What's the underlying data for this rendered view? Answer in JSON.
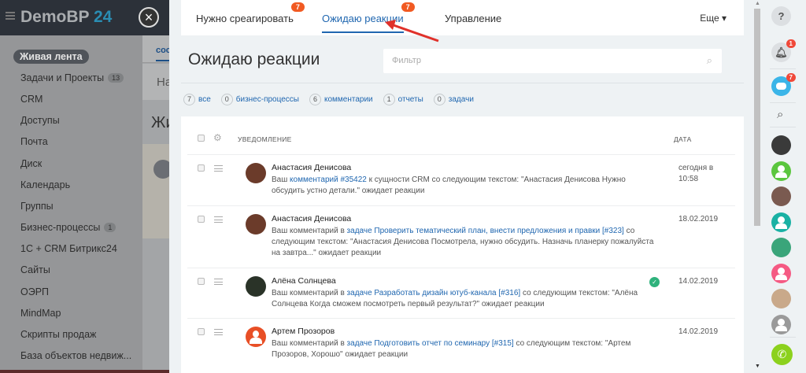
{
  "app": {
    "logo_main": "DemoBP",
    "logo_num": "24",
    "close_label": "×"
  },
  "sidebar": {
    "items": [
      {
        "label": "Живая лента",
        "active": true
      },
      {
        "label": "Задачи и Проекты",
        "count": "13"
      },
      {
        "label": "CRM"
      },
      {
        "label": "Доступы"
      },
      {
        "label": "Почта"
      },
      {
        "label": "Диск"
      },
      {
        "label": "Календарь"
      },
      {
        "label": "Группы"
      },
      {
        "label": "Бизнес-процессы",
        "count": "1"
      },
      {
        "label": "1С + CRM Битрикс24"
      },
      {
        "label": "Сайты"
      },
      {
        "label": "ОЭРП"
      },
      {
        "label": "MindMap"
      },
      {
        "label": "Скрипты продаж"
      },
      {
        "label": "База объектов недвиж..."
      }
    ]
  },
  "behind": {
    "tab_fragment": "сос",
    "box_fragment": "На",
    "title_fragment": "Жи"
  },
  "tabs": [
    {
      "label": "Нужно среагировать",
      "badge": "7"
    },
    {
      "label": "Ожидаю реакции",
      "badge": "7",
      "active": true
    },
    {
      "label": "Управление"
    }
  ],
  "more_label": "Еще ▾",
  "page_title": "Ожидаю реакции",
  "filter": {
    "placeholder": "Фильтр"
  },
  "counters": [
    {
      "count": "7",
      "label": "все"
    },
    {
      "count": "0",
      "label": "бизнес-процессы"
    },
    {
      "count": "6",
      "label": "комментарии"
    },
    {
      "count": "1",
      "label": "отчеты"
    },
    {
      "count": "0",
      "label": "задачи"
    }
  ],
  "table": {
    "col_notification": "УВЕДОМЛЕНИЕ",
    "col_date": "ДАТА",
    "rows": [
      {
        "name": "Анастасия Денисова",
        "pre": "Ваш ",
        "link": "комментарий #35422",
        "post": " к сущности CRM со следующим текстом: \"Анастасия Денисова Нужно обсудить устно детали.\" ожидает реакции",
        "date": "сегодня в 10:58",
        "avatar_color": "#6b3b2a"
      },
      {
        "name": "Анастасия Денисова",
        "pre": "Ваш комментарий в ",
        "link": "задаче Проверить тематический план, внести предложения и правки [#323]",
        "post": " со следующим текстом: \"Анастасия Денисова Посмотрела, нужно обсудить. Назначь планерку пожалуйста на завтра...\" ожидает реакции",
        "date": "18.02.2019",
        "avatar_color": "#6b3b2a"
      },
      {
        "name": "Алёна Солнцева",
        "pre": "Ваш комментарий в ",
        "link": "задаче Разработать дизайн ютуб-канала [#316]",
        "post": " со следующим текстом: \"Алёна Солнцева Когда сможем посмотреть первый результат?\" ожидает реакции",
        "date": "14.02.2019",
        "avatar_color": "#2a3328",
        "done": true
      },
      {
        "name": "Артем Прозоров",
        "pre": "Ваш комментарий в ",
        "link": "задаче Подготовить отчет по семинару [#315]",
        "post": " со следующим текстом: \"Артем Прозоров, Хорошо\" ожидает реакции",
        "date": "14.02.2019",
        "avatar_color": "#e84f26",
        "default_avatar": true
      }
    ]
  },
  "rightbar": {
    "help_icon": "?",
    "notifications_badge": "1",
    "bot_badge": "7",
    "contacts_colors": [
      "#3a3a3a",
      "#5bc63e",
      "#7a5a50",
      "#19b1a4",
      "#3aa57a",
      "#f55a83",
      "#c9a98a",
      "#9a9a9a"
    ],
    "phone_color": "#8cd11d"
  },
  "colors": {
    "accent": "#2067b0",
    "badge": "#f15a22",
    "arrow": "#e0312a"
  }
}
